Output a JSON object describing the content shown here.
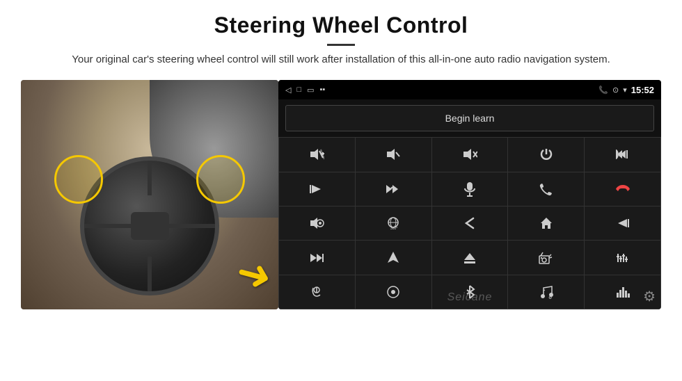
{
  "header": {
    "title": "Steering Wheel Control",
    "subtitle": "Your original car's steering wheel control will still work after installation of this all-in-one auto radio navigation system."
  },
  "status_bar": {
    "back_icon": "◁",
    "home_icon": "□",
    "recent_icon": "▭",
    "signal_icon": "▪▪",
    "time": "15:52",
    "phone_icon": "📞",
    "location_icon": "⊙",
    "wifi_icon": "▾"
  },
  "begin_learn": {
    "label": "Begin learn"
  },
  "grid_buttons": [
    {
      "icon": "🔊+",
      "label": "vol-up"
    },
    {
      "icon": "🔊−",
      "label": "vol-down"
    },
    {
      "icon": "🔇",
      "label": "mute"
    },
    {
      "icon": "⏻",
      "label": "power"
    },
    {
      "icon": "📞⏮",
      "label": "call-prev"
    },
    {
      "icon": "⏭",
      "label": "next-track"
    },
    {
      "icon": "✂⏭",
      "label": "skip"
    },
    {
      "icon": "🎙",
      "label": "mic"
    },
    {
      "icon": "📞",
      "label": "phone"
    },
    {
      "icon": "☎↩",
      "label": "hang-up"
    },
    {
      "icon": "🔈",
      "label": "speaker"
    },
    {
      "icon": "🔄360",
      "label": "360-view"
    },
    {
      "icon": "↩",
      "label": "back"
    },
    {
      "icon": "⌂",
      "label": "home"
    },
    {
      "icon": "⏮⏮",
      "label": "prev-track"
    },
    {
      "icon": "⏭⏭",
      "label": "fast-forward"
    },
    {
      "icon": "▲",
      "label": "nav"
    },
    {
      "icon": "⏏",
      "label": "eject"
    },
    {
      "icon": "📻",
      "label": "radio"
    },
    {
      "icon": "≡|≡",
      "label": "equalizer"
    },
    {
      "icon": "🎤",
      "label": "voice"
    },
    {
      "icon": "⊙",
      "label": "menu"
    },
    {
      "icon": "✱",
      "label": "bluetooth"
    },
    {
      "icon": "🎵",
      "label": "music"
    },
    {
      "icon": "|||",
      "label": "visualizer"
    }
  ],
  "watermark": {
    "text": "Seicane"
  },
  "icons": {
    "gear": "⚙"
  }
}
